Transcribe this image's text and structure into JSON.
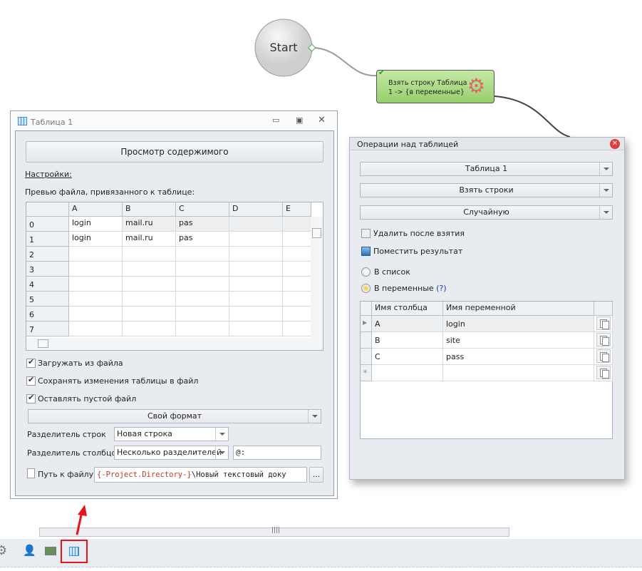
{
  "flow": {
    "start_label": "Start",
    "node_label_1": "Взять строку Таблица",
    "node_label_2": "1 -> {в переменные}",
    "node_color": "#a6d87f"
  },
  "table_window": {
    "title": "Таблица 1",
    "view_button": "Просмотр содержимого",
    "settings_link": "Настройки:",
    "preview_label": "Превью файла, привязанного к таблице:",
    "columns": [
      "",
      "A",
      "B",
      "C",
      "D",
      "E"
    ],
    "rows": [
      [
        "0",
        "login",
        "mail.ru",
        "pas",
        "",
        ""
      ],
      [
        "1",
        "login",
        "mail.ru",
        "pas",
        "",
        ""
      ],
      [
        "2",
        "",
        "",
        "",
        "",
        ""
      ],
      [
        "3",
        "",
        "",
        "",
        "",
        ""
      ],
      [
        "4",
        "",
        "",
        "",
        "",
        ""
      ],
      [
        "5",
        "",
        "",
        "",
        "",
        ""
      ],
      [
        "6",
        "",
        "",
        "",
        "",
        ""
      ],
      [
        "7",
        "",
        "",
        "",
        "",
        ""
      ]
    ],
    "load_from_file": "Загружать из файла",
    "save_changes": "Сохранять изменения таблицы в файл",
    "keep_empty": "Оставлять пустой файл",
    "format": "Свой формат",
    "row_sep_label": "Разделитель строк",
    "row_sep_value": "Новая строка",
    "col_sep_label": "Разделитель столбцов",
    "col_sep_value": "Несколько разделителей",
    "col_sep_chars": "@:",
    "path_label": "Путь к файлу",
    "path_var": "{-Project.Directory-}",
    "path_rest": "\\Новый текстовый доку",
    "browse": "..."
  },
  "ops_dialog": {
    "title": "Операции над таблицей",
    "table": "Таблица 1",
    "action": "Взять строки",
    "mode": "Случайную",
    "delete_after": "Удалить после взятия",
    "put_result": "Поместить результат",
    "to_list": "В список",
    "to_vars": "В переменные",
    "help": "(?)",
    "columns": [
      "Имя столбца",
      "Имя переменной"
    ],
    "rows": [
      [
        "A",
        "login"
      ],
      [
        "B",
        "site"
      ],
      [
        "C",
        "pass"
      ],
      [
        "",
        ""
      ]
    ]
  },
  "highlight_color": "#e8121a"
}
